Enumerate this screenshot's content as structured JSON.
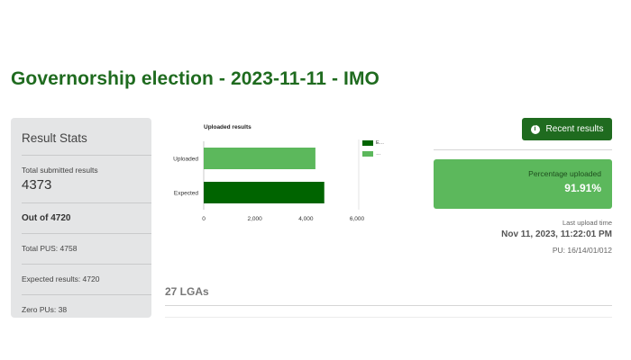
{
  "page": {
    "title": "Governorship election - 2023-11-11 - IMO"
  },
  "stats": {
    "title": "Result Stats",
    "total_submitted_label": "Total submitted results",
    "total_submitted_value": "4373",
    "out_of": "Out of 4720",
    "total_pus": "Total PUS: 4758",
    "expected_results": "Expected results: 4720",
    "zero_pus": "Zero PUs: 38"
  },
  "chart_data": {
    "type": "bar",
    "orientation": "horizontal",
    "title": "Uploaded results",
    "categories": [
      "Uploaded",
      "Expected"
    ],
    "values": [
      4373,
      4720
    ],
    "bar_colors": [
      "#5cb85c",
      "#006400"
    ],
    "xlim": [
      0,
      6000
    ],
    "xticks": [
      0,
      2000,
      4000,
      6000
    ],
    "xtick_labels": [
      "0",
      "2,000",
      "4,000",
      "6,000"
    ],
    "legend": [
      {
        "label": "E…",
        "color": "#006400"
      },
      {
        "label": "…",
        "color": "#5cb85c"
      }
    ],
    "legend_position": "right"
  },
  "recent": {
    "button_label": "Recent results",
    "icon": "info-icon"
  },
  "upload": {
    "percentage_label": "Percentage uploaded",
    "percentage_value": "91.91%",
    "last_upload_label": "Last upload time",
    "last_upload_time": "Nov 11, 2023, 11:22:01 PM",
    "pu_code": "PU: 16/14/01/012"
  },
  "lga": {
    "heading": "27 LGAs"
  },
  "colors": {
    "brand_dark_green": "#1f6b1f",
    "accent_green": "#5cb85c",
    "card_gray": "#e4e5e6"
  }
}
